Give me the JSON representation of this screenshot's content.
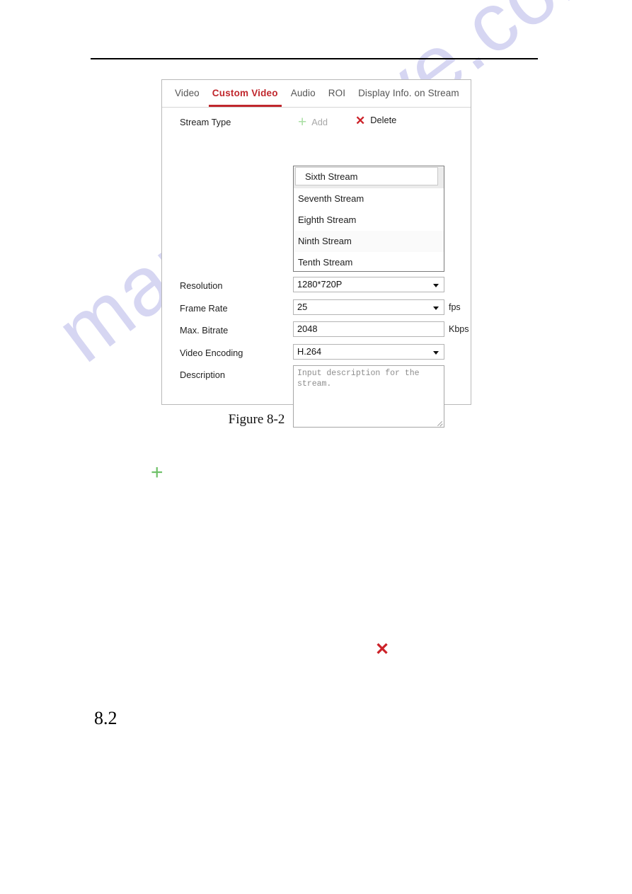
{
  "document": {
    "figure_caption": "Figure 8-2",
    "section_heading": "8.2",
    "watermark": "manualshive.com",
    "accent_color": "#c0272d",
    "add_icon_color": "#6dc067",
    "delete_icon_color": "#cc2229"
  },
  "panel": {
    "tabs": [
      {
        "label": "Video",
        "active": false
      },
      {
        "label": "Custom Video",
        "active": true
      },
      {
        "label": "Audio",
        "active": false
      },
      {
        "label": "ROI",
        "active": false
      },
      {
        "label": "Display Info. on Stream",
        "active": false
      }
    ],
    "stream_type": {
      "label": "Stream Type",
      "add_label": "Add",
      "add_icon": "plus-icon",
      "delete_label": "Delete",
      "delete_icon": "cross-icon",
      "items": [
        {
          "label": "Sixth Stream",
          "state": "selected"
        },
        {
          "label": "Seventh Stream",
          "state": "normal"
        },
        {
          "label": "Eighth Stream",
          "state": "normal"
        },
        {
          "label": "Ninth Stream",
          "state": "hovered"
        },
        {
          "label": "Tenth Stream",
          "state": "normal"
        }
      ]
    },
    "fields": {
      "resolution": {
        "label": "Resolution",
        "value": "1280*720P",
        "unit": ""
      },
      "frame_rate": {
        "label": "Frame Rate",
        "value": "25",
        "unit": "fps"
      },
      "max_bitrate": {
        "label": "Max. Bitrate",
        "value": "2048",
        "unit": "Kbps"
      },
      "video_encoding": {
        "label": "Video Encoding",
        "value": "H.264",
        "unit": ""
      },
      "description": {
        "label": "Description",
        "value": "",
        "placeholder": "Input description for the stream."
      }
    }
  }
}
